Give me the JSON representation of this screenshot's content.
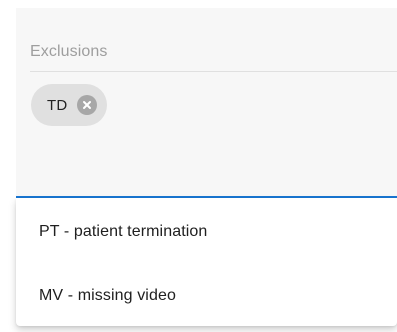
{
  "field": {
    "label": "Exclusions",
    "chips": [
      {
        "label": "TD",
        "delete_icon": "cancel-circle-icon"
      }
    ]
  },
  "menu": {
    "items": [
      {
        "label": "PT - patient termination"
      },
      {
        "label": "MV - missing video"
      }
    ]
  },
  "colors": {
    "accent": "#1976d2",
    "chip_bg": "#e0e0e0",
    "field_bg": "#f7f7f7",
    "label": "#9e9e9e"
  }
}
